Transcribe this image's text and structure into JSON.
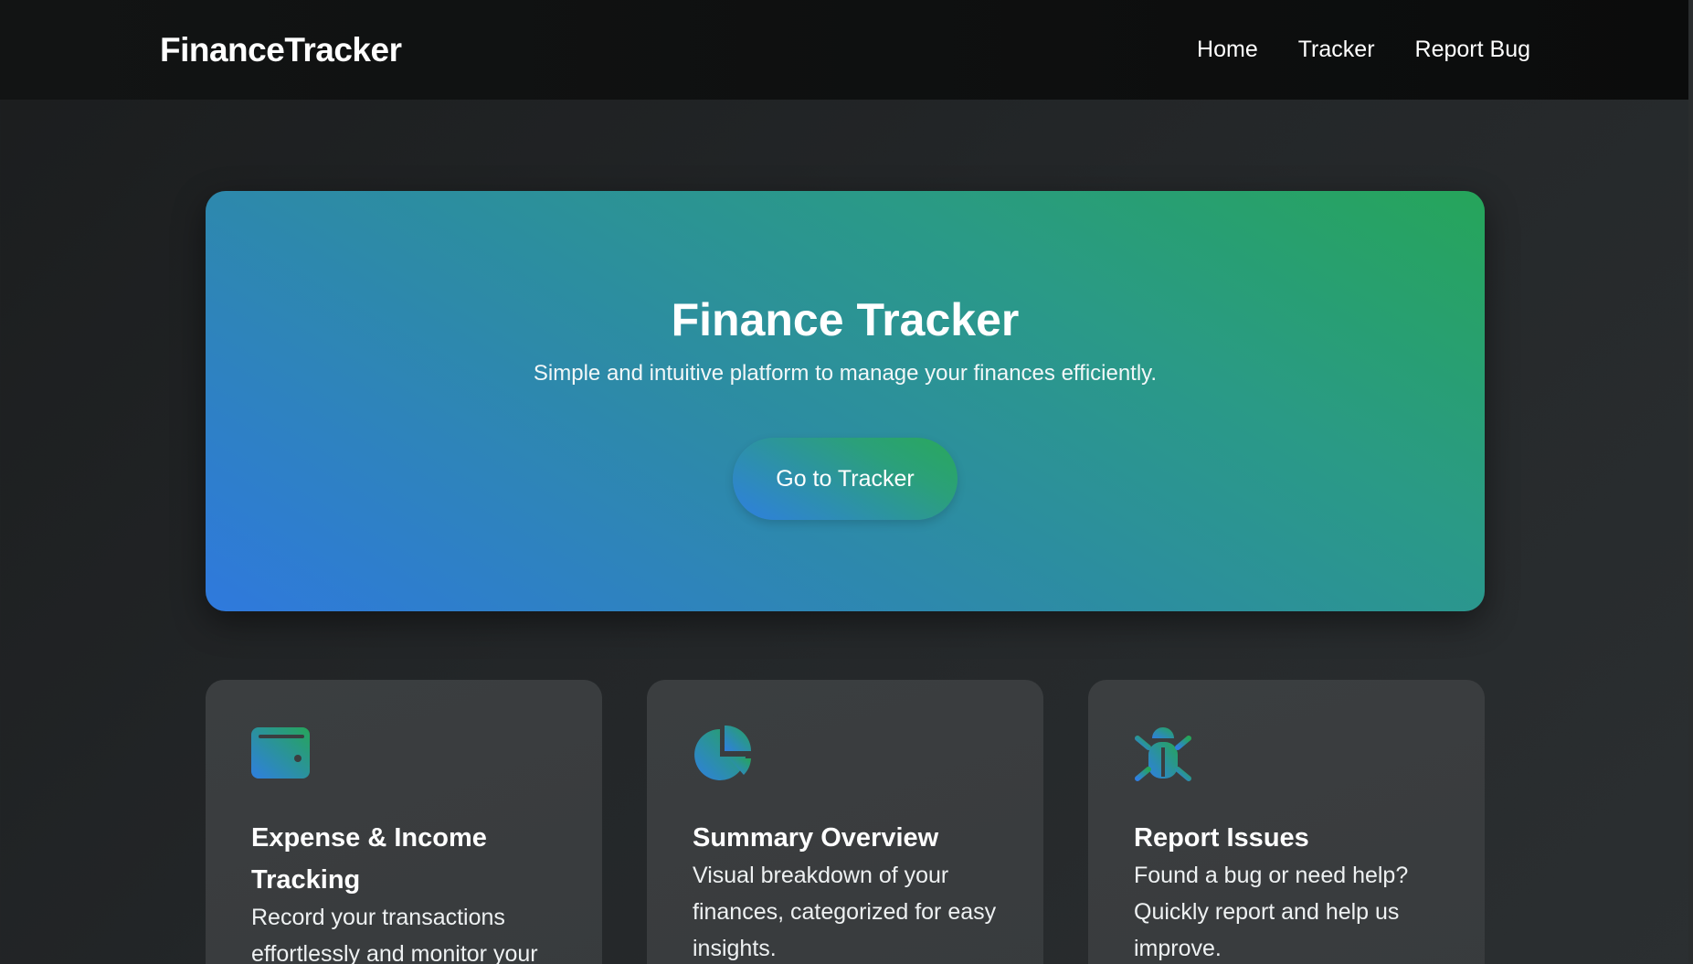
{
  "navbar": {
    "brand": "FinanceTracker",
    "links": [
      "Home",
      "Tracker",
      "Report Bug"
    ]
  },
  "hero": {
    "title": "Finance Tracker",
    "subtitle": "Simple and intuitive platform to manage your finances efficiently.",
    "button_label": "Go to Tracker"
  },
  "features": [
    {
      "icon": "wallet-icon",
      "title": "Expense & Income Tracking",
      "text": "Record your transactions effortlessly and monitor your"
    },
    {
      "icon": "pie-chart-icon",
      "title": "Summary Overview",
      "text": "Visual breakdown of your finances, categorized for easy insights."
    },
    {
      "icon": "bug-icon",
      "title": "Report Issues",
      "text": "Found a bug or need help? Quickly report and help us improve."
    }
  ],
  "colors": {
    "gradient_blue": "#2f79dd",
    "gradient_green": "#26a55a",
    "card_bg": "#3b3e40",
    "nav_bg": "#0d0f0f"
  }
}
